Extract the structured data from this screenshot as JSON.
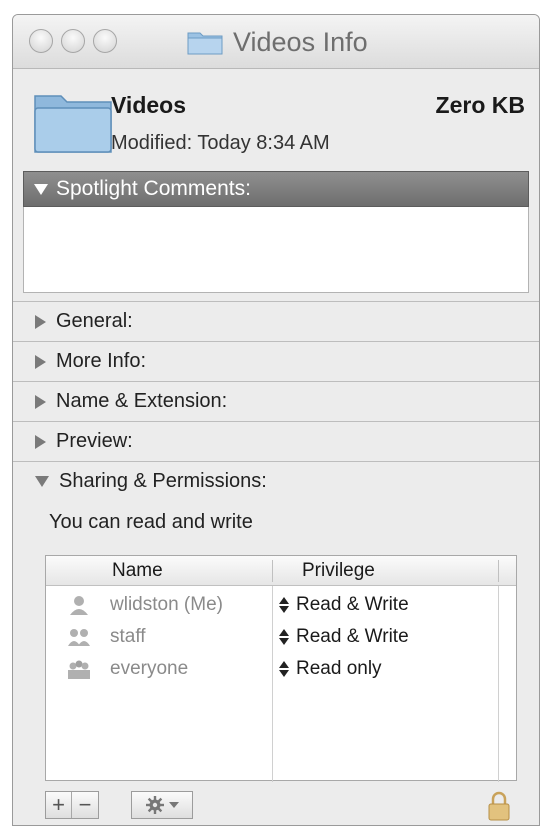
{
  "window": {
    "title": "Videos Info"
  },
  "file": {
    "name": "Videos",
    "size": "Zero KB",
    "modified": "Modified: Today 8:34 AM"
  },
  "spotlight": {
    "label": "Spotlight Comments:"
  },
  "sections": {
    "general": "General:",
    "more_info": "More Info:",
    "name_extension": "Name & Extension:",
    "preview": "Preview:",
    "sharing": "Sharing & Permissions:"
  },
  "permissions": {
    "status": "You can read and write",
    "columns": [
      "Name",
      "Privilege"
    ],
    "rows": [
      {
        "name": "wlidston (Me)",
        "privilege": "Read & Write",
        "icon": "single-user-icon"
      },
      {
        "name": "staff",
        "privilege": "Read & Write",
        "icon": "group-icon"
      },
      {
        "name": "everyone",
        "privilege": "Read only",
        "icon": "everyone-icon"
      }
    ]
  },
  "toolbar": {
    "add_label": "+",
    "remove_label": "−"
  },
  "colors": {
    "folder_blue": "#8fb8dc",
    "section_header_gray": "#7a7a7a"
  }
}
